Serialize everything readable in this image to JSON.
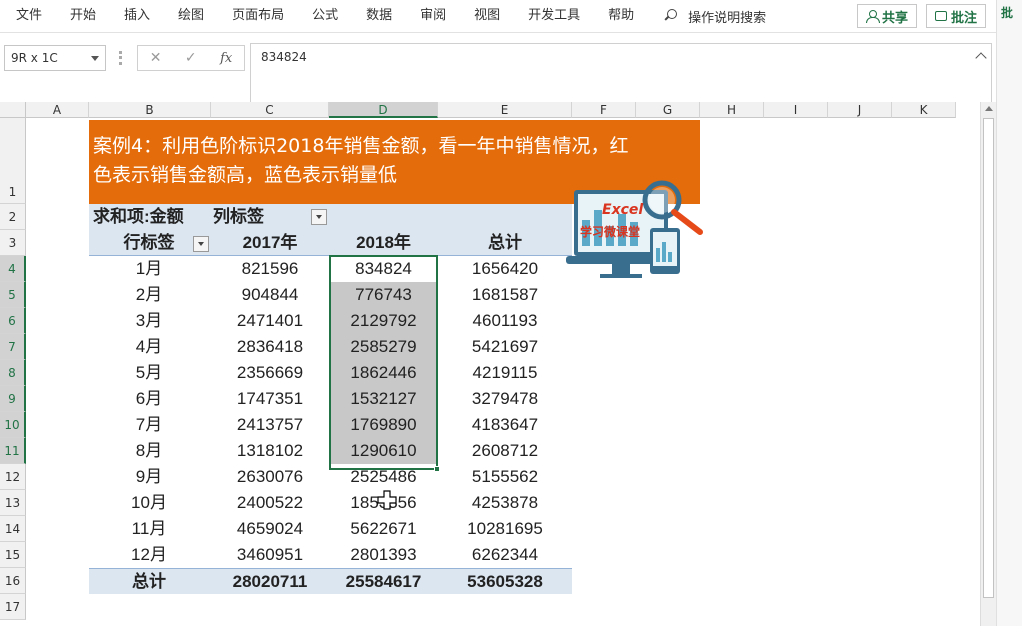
{
  "menu": {
    "items": [
      "文件",
      "开始",
      "插入",
      "绘图",
      "页面布局",
      "公式",
      "数据",
      "审阅",
      "视图",
      "开发工具",
      "帮助"
    ],
    "search_label": "操作说明搜索",
    "share_label": "共享",
    "comment_label": "批注",
    "right_partial": "批"
  },
  "formula_bar": {
    "name_box": "9R x 1C",
    "fx": "fx",
    "value": "834824"
  },
  "grid": {
    "columns": [
      "A",
      "B",
      "C",
      "D",
      "E",
      "F",
      "G",
      "H",
      "I",
      "J",
      "K"
    ],
    "selected_column": "D",
    "rows": [
      "1",
      "2",
      "3",
      "4",
      "5",
      "6",
      "7",
      "8",
      "9",
      "10",
      "11",
      "12",
      "13",
      "14",
      "15",
      "16",
      "17"
    ]
  },
  "title": {
    "line1": "案例4：利用色阶标识2018年销售金额，看一年中销售情况，红",
    "line2": "色表示销售金额高，蓝色表示销量低"
  },
  "pivot": {
    "sum_label": "求和项:金额",
    "col_label": "列标签",
    "row_label": "行标签",
    "headers": [
      "2017年",
      "2018年",
      "总计"
    ],
    "rows": [
      {
        "month": "1月",
        "y2017": "821596",
        "y2018": "834824",
        "total": "1656420"
      },
      {
        "month": "2月",
        "y2017": "904844",
        "y2018": "776743",
        "total": "1681587"
      },
      {
        "month": "3月",
        "y2017": "2471401",
        "y2018": "2129792",
        "total": "4601193"
      },
      {
        "month": "4月",
        "y2017": "2836418",
        "y2018": "2585279",
        "total": "5421697"
      },
      {
        "month": "5月",
        "y2017": "2356669",
        "y2018": "1862446",
        "total": "4219115"
      },
      {
        "month": "6月",
        "y2017": "1747351",
        "y2018": "1532127",
        "total": "3279478"
      },
      {
        "month": "7月",
        "y2017": "2413757",
        "y2018": "1769890",
        "total": "4183647"
      },
      {
        "month": "8月",
        "y2017": "1318102",
        "y2018": "1290610",
        "total": "2608712"
      },
      {
        "month": "9月",
        "y2017": "2630076",
        "y2018": "2525486",
        "total": "5155562"
      },
      {
        "month": "10月",
        "y2017": "2400522",
        "y2018": "1853356",
        "total": "4253878"
      },
      {
        "month": "11月",
        "y2017": "4659024",
        "y2018": "5622671",
        "total": "10281695"
      },
      {
        "month": "12月",
        "y2017": "3460951",
        "y2018": "2801393",
        "total": "6262344"
      }
    ],
    "total_row": {
      "label": "总计",
      "y2017": "28020711",
      "y2018": "25584617",
      "total": "53605328"
    }
  },
  "logo": {
    "text": "Excel",
    "subtitle": "学习微课堂"
  },
  "colors": {
    "banner": "#e46c0a",
    "excel_green": "#217346",
    "pivot_header": "#dce6f1",
    "selection_fill": "#c8c8c8"
  }
}
